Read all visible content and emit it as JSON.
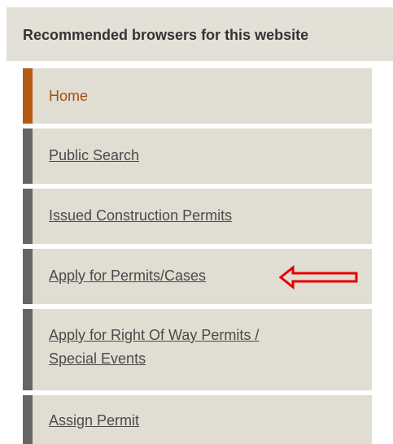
{
  "banner": {
    "text": "Recommended browsers for this website"
  },
  "nav": {
    "items": [
      {
        "label": "Home",
        "active": true
      },
      {
        "label": "Public Search",
        "active": false
      },
      {
        "label": "Issued Construction Permits",
        "active": false
      },
      {
        "label": "Apply for Permits/Cases",
        "active": false
      },
      {
        "label": "Apply for Right Of Way Permits /\nSpecial Events",
        "active": false
      },
      {
        "label": "Assign Permit",
        "active": false
      }
    ]
  },
  "annotation": {
    "arrow_icon": "left-arrow-icon",
    "arrow_color": "#e30000"
  },
  "colors": {
    "active_accent": "#b35a14",
    "inactive_accent": "#666666",
    "item_background": "#e0ddd3"
  }
}
